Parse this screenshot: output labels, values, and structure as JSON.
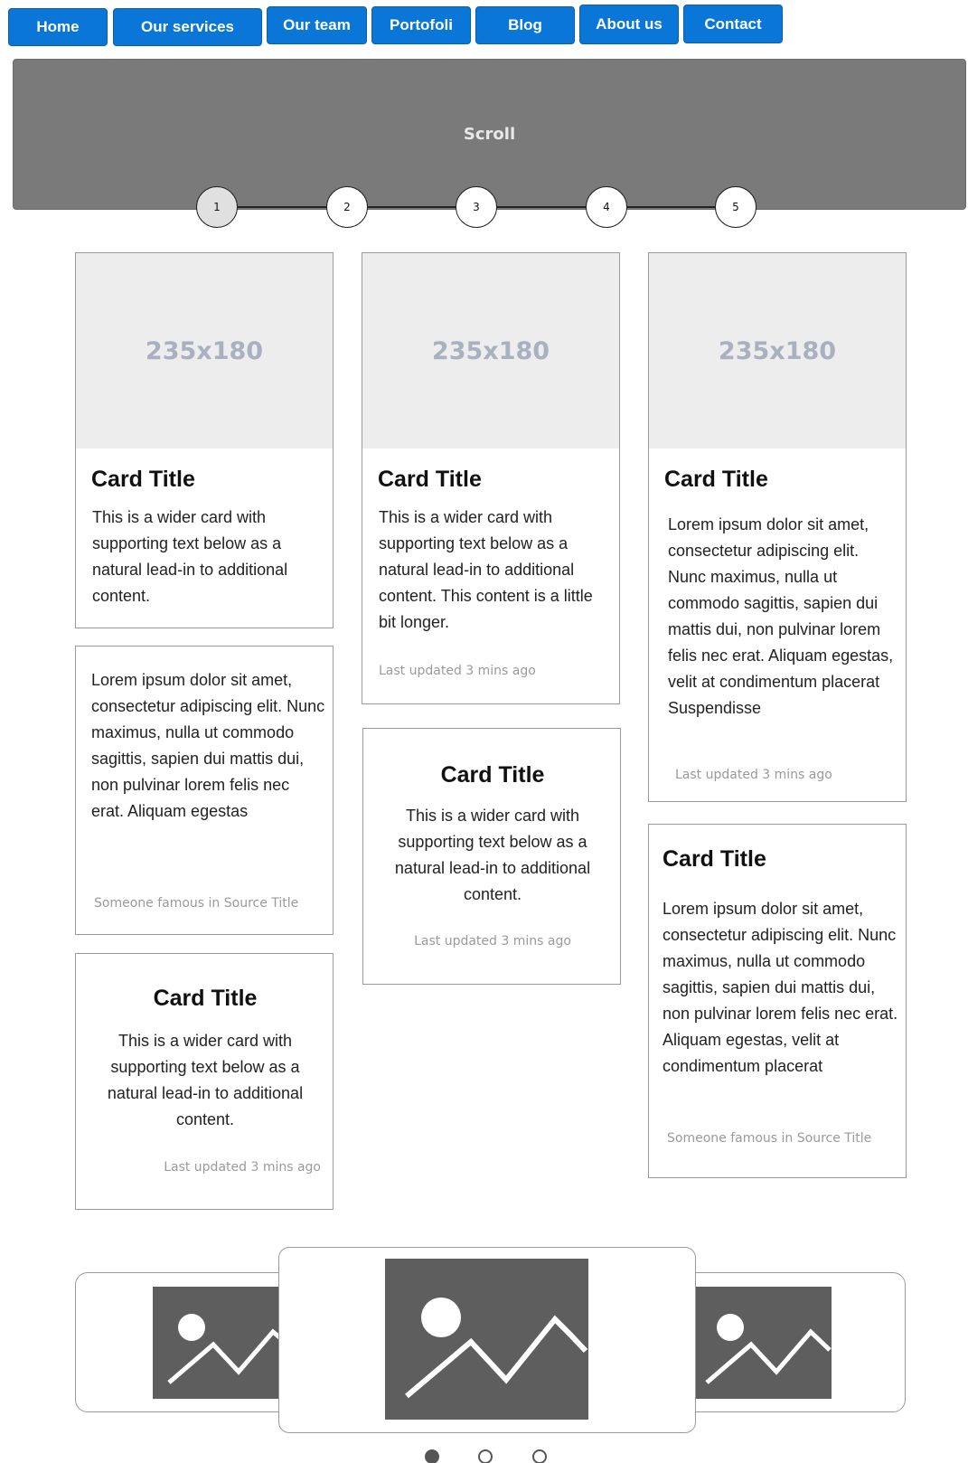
{
  "nav": {
    "items": [
      "Home",
      "Our services",
      "Our team",
      "Portofoli",
      "Blog",
      "About us",
      "Contact"
    ]
  },
  "hero": {
    "label": "Scroll",
    "steps": [
      "1",
      "2",
      "3",
      "4",
      "5"
    ],
    "active_step": 1
  },
  "cards": {
    "card1": {
      "image_placeholder": "235x180",
      "title": "Card Title",
      "text": "This is a wider card with supporting text below as a natural lead-in to additional content."
    },
    "card2": {
      "text": "Lorem ipsum dolor sit amet, consectetur adipiscing elit. Nunc maximus, nulla ut commodo sagittis, sapien dui mattis dui, non pulvinar lorem felis nec erat. Aliquam egestas",
      "source": "Someone famous in Source Title"
    },
    "card3": {
      "title": "Card Title",
      "text": "This is a wider card with supporting text below as a natural lead-in to additional content.",
      "meta": "Last updated 3 mins ago"
    },
    "card4": {
      "image_placeholder": "235x180",
      "title": "Card Title",
      "text": "This is a wider card with supporting text below as a natural lead-in to additional content. This content is a little bit longer.",
      "meta": "Last updated 3 mins ago"
    },
    "card5": {
      "title": "Card Title",
      "text": "This is a wider card with supporting text below as a natural lead-in to additional content.",
      "meta": "Last updated 3 mins ago"
    },
    "card6": {
      "image_placeholder": "235x180",
      "title": "Card Title",
      "text": "Lorem ipsum dolor sit amet, consectetur adipiscing elit. Nunc maximus, nulla ut commodo sagittis, sapien dui mattis dui, non pulvinar lorem felis nec erat. Aliquam egestas, velit at condimentum placerat Suspendisse",
      "meta": "Last updated 3 mins ago"
    },
    "card7": {
      "title": "Card Title",
      "text": "Lorem ipsum dolor sit amet, consectetur adipiscing elit. Nunc maximus, nulla ut commodo sagittis, sapien dui mattis dui, non pulvinar lorem felis nec erat. Aliquam egestas, velit at condimentum placerat",
      "source": "Someone famous in Source Title"
    }
  },
  "carousel": {
    "image_icon": "image-icon",
    "slide_count": 3,
    "active_slide": 1
  },
  "colors": {
    "nav_blue": "#0a76d8",
    "hero_gray": "#7a7a7a",
    "placeholder_bg": "#ededed",
    "placeholder_text": "#a9b0bf",
    "image_gray": "#5e5e5e"
  }
}
